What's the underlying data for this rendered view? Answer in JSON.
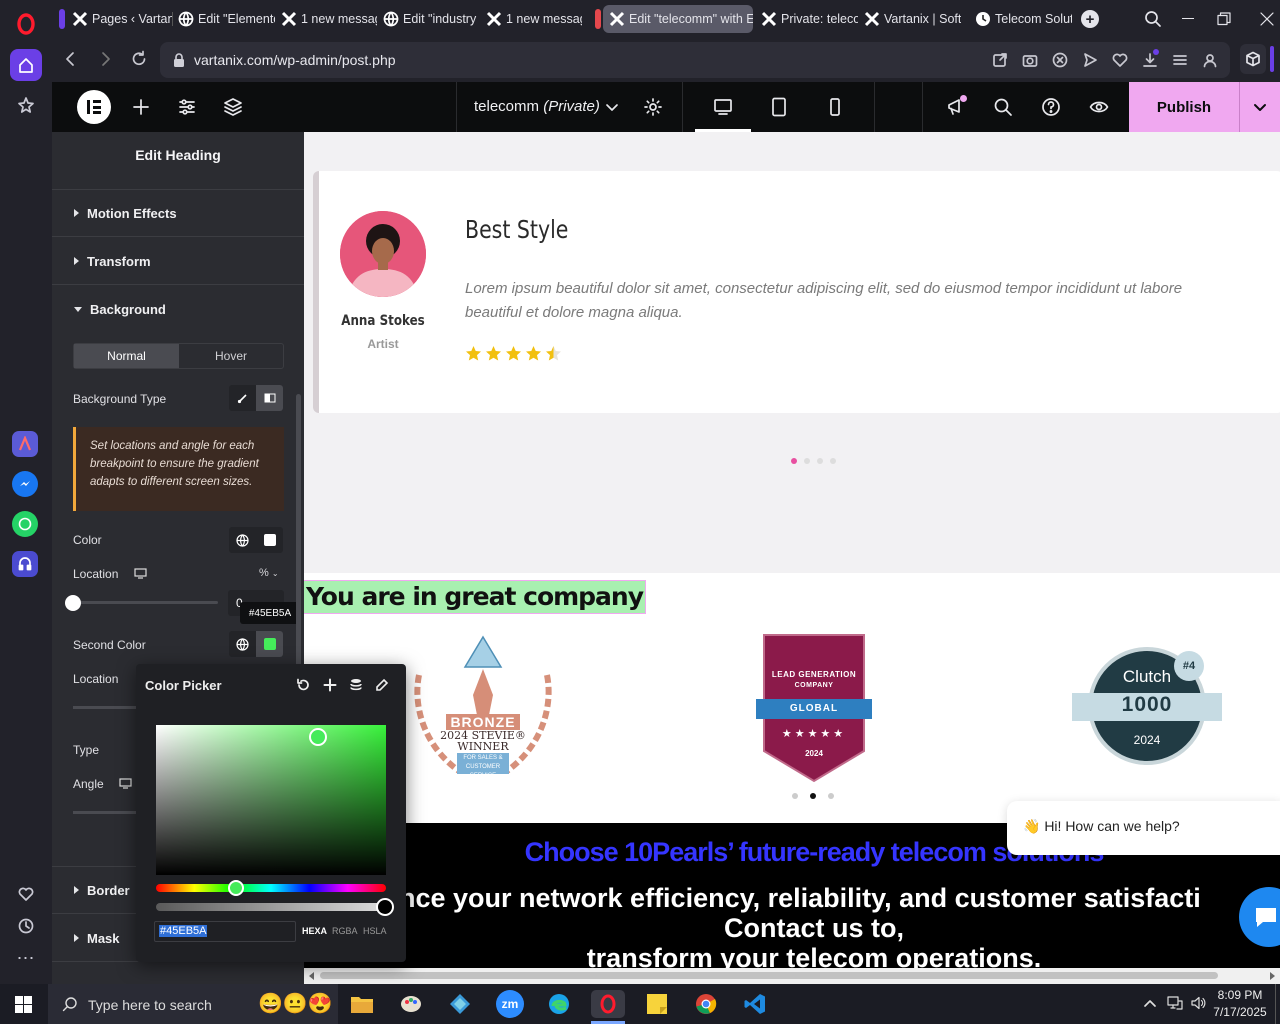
{
  "browser": {
    "tabs": [
      {
        "label": "Pages ‹ Vartan",
        "icon": "wordpress-icon"
      },
      {
        "label": "Edit \"Elemento",
        "icon": "globe-icon"
      },
      {
        "label": "1 new messag",
        "icon": "x-icon"
      },
      {
        "label": "Edit \"industry",
        "icon": "globe-icon"
      },
      {
        "label": "1 new messag",
        "icon": "x-icon"
      },
      {
        "label": "Edit \"telecomm\" with E",
        "icon": "x-icon"
      },
      {
        "label": "Private: teleco",
        "icon": "x-icon"
      },
      {
        "label": "Vartanix | Soft",
        "icon": "x-icon"
      },
      {
        "label": "Telecom Solut",
        "icon": "clock-icon"
      }
    ],
    "url": "vartanix.com/wp-admin/post.php"
  },
  "elementor": {
    "page_name": "telecomm",
    "page_status": "(Private)",
    "publish_label": "Publish"
  },
  "panel": {
    "title": "Edit Heading",
    "sections": {
      "motion": "Motion Effects",
      "transform": "Transform",
      "background": "Background",
      "border": "Border",
      "mask": "Mask"
    },
    "tabs": {
      "normal": "Normal",
      "hover": "Hover"
    },
    "bg_type_label": "Background Type",
    "notice": "Set locations and angle for each breakpoint to ensure the gradient adapts to different screen sizes.",
    "color_label": "Color",
    "location_label": "Location",
    "location_unit": "%",
    "location_value": "0",
    "second_color_label": "Second Color",
    "second_color_tooltip": "#45EB5A",
    "location2_label": "Location",
    "type_label": "Type",
    "angle_label": "Angle"
  },
  "color_picker": {
    "title": "Color Picker",
    "hex_value": "#45EB5A",
    "modes": [
      "HEXA",
      "RGBA",
      "HSLA"
    ],
    "selected_color": "#45EB5A"
  },
  "canvas": {
    "testimonial": {
      "name": "Anna Stokes",
      "role": "Artist",
      "title": "Best Style",
      "body": "Lorem ipsum beautiful dolor sit amet, consectetur adipiscing elit, sed do eiusmod tempor incididunt ut labore beautiful et dolore magna aliqua.",
      "rating": 4.5,
      "rating_max": 5
    },
    "heading": "You are in great company",
    "badges": {
      "stevie": {
        "line1": "BRONZE",
        "line2": "2024 STEVIE®",
        "line3": "WINNER",
        "line4": "FOR SALES &",
        "line5": "CUSTOMER SERVICE"
      },
      "leadgen": {
        "top": "LEAD GENERATION",
        "mid": "COMPANY",
        "ribbon": "GLOBAL",
        "year": "2024"
      },
      "clutch": {
        "brand": "Clutch",
        "num": "1000",
        "year": "2024",
        "rank": "#4"
      }
    },
    "cta": {
      "line1": "Choose 10Pearls’ future-ready telecom solutions",
      "line2": "nce your network efficiency, reliability, and customer satisfacti",
      "line3": "Contact us to,",
      "line4": "transform your telecom operations."
    },
    "chat_bubble": "👋 Hi! How can we help?"
  },
  "taskbar": {
    "search_placeholder": "Type here to search",
    "time": "8:09 PM",
    "date": "7/17/2025"
  },
  "colors": {
    "publish_bg": "#f0a8f0",
    "accent_green": "#45EB5A",
    "cta_blue": "#3535ff",
    "panel_bg": "#2b2c31"
  }
}
